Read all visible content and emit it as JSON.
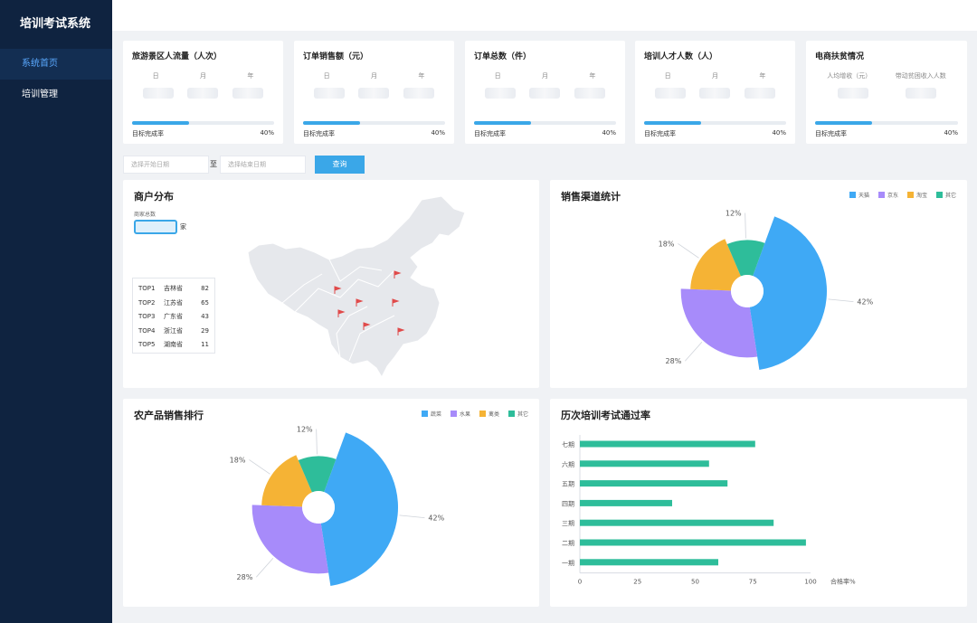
{
  "app": {
    "title": "培训考试系统"
  },
  "sidebar": {
    "items": [
      {
        "label": "系统首页",
        "active": true
      },
      {
        "label": "培训管理",
        "active": false
      }
    ]
  },
  "stats": [
    {
      "title": "旅游景区人流量（人次）",
      "cols": [
        "日",
        "月",
        "年"
      ],
      "footer_label": "目标完成率",
      "rate": 40,
      "rate_text": "40%"
    },
    {
      "title": "订单销售额（元）",
      "cols": [
        "日",
        "月",
        "年"
      ],
      "footer_label": "目标完成率",
      "rate": 40,
      "rate_text": "40%"
    },
    {
      "title": "订单总数（件）",
      "cols": [
        "日",
        "月",
        "年"
      ],
      "footer_label": "目标完成率",
      "rate": 40,
      "rate_text": "40%"
    },
    {
      "title": "培训人才人数（人）",
      "cols": [
        "日",
        "月",
        "年"
      ],
      "footer_label": "目标完成率",
      "rate": 40,
      "rate_text": "40%"
    },
    {
      "title": "电商扶贫情况",
      "cols": [
        "人均增收（元）",
        "带动贫困收入人数"
      ],
      "footer_label": "目标完成率",
      "rate": 40,
      "rate_text": "40%"
    }
  ],
  "filter": {
    "start_placeholder": "选择开始日期",
    "separator": "至",
    "end_placeholder": "选择结束日期",
    "query_label": "查询"
  },
  "merchant": {
    "title": "商户分布",
    "count_label": "商家总数",
    "count_unit": "家",
    "top5": [
      {
        "rank": "TOP1",
        "province": "吉林省",
        "value": "82"
      },
      {
        "rank": "TOP2",
        "province": "江苏省",
        "value": "65"
      },
      {
        "rank": "TOP3",
        "province": "广东省",
        "value": "43"
      },
      {
        "rank": "TOP4",
        "province": "浙江省",
        "value": "29"
      },
      {
        "rank": "TOP5",
        "province": "湖南省",
        "value": "11"
      }
    ]
  },
  "colors": {
    "blue": "#3fa9f5",
    "purple": "#a78bfa",
    "orange": "#f5b335",
    "green": "#2ebd9a",
    "bar": "#2ebd9a",
    "primary": "#3aa7e8"
  },
  "chart_data": [
    {
      "type": "pie",
      "title": "销售渠道统计",
      "labels": [
        "天猫",
        "京东",
        "淘宝",
        "其它"
      ],
      "values": [
        42,
        28,
        18,
        12
      ],
      "value_labels": [
        "42%",
        "28%",
        "18%",
        "12%"
      ],
      "legend": "top-right"
    },
    {
      "type": "pie",
      "title": "农产品销售排行",
      "labels": [
        "蔬菜",
        "水果",
        "禽类",
        "其它"
      ],
      "values": [
        42,
        28,
        18,
        12
      ],
      "value_labels": [
        "42%",
        "28%",
        "18%",
        "12%"
      ],
      "legend": "top-right"
    },
    {
      "type": "bar",
      "orientation": "horizontal",
      "title": "历次培训考试通过率",
      "categories": [
        "七期",
        "六期",
        "五期",
        "四期",
        "三期",
        "二期",
        "一期"
      ],
      "values": [
        76,
        56,
        64,
        40,
        84,
        98,
        60
      ],
      "xlabel": "合格率%",
      "xlim": [
        0,
        100
      ],
      "xticks": [
        "0",
        "25",
        "50",
        "75",
        "100"
      ]
    }
  ]
}
